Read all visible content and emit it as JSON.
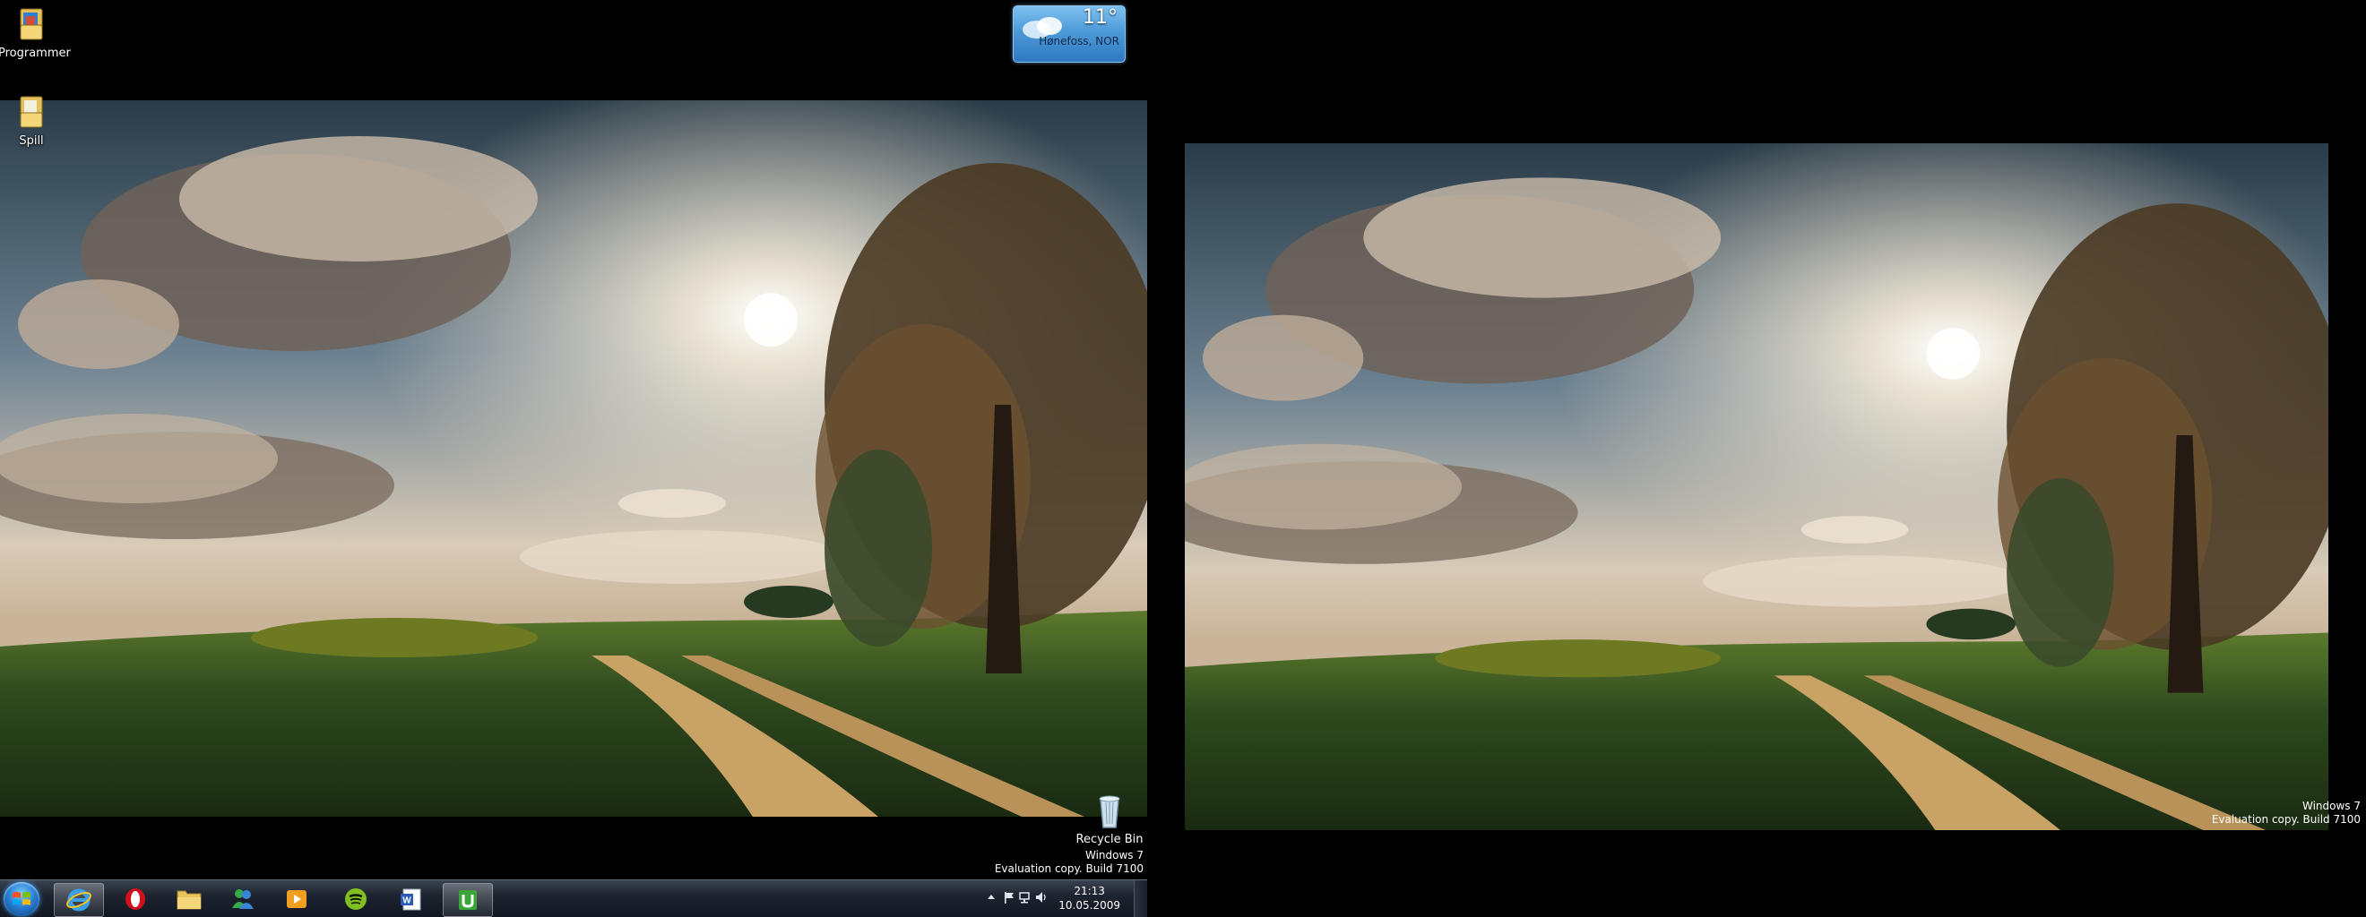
{
  "desktop": {
    "icons": [
      {
        "label": "Programmer"
      },
      {
        "label": "Spill"
      },
      {
        "label": "Recycle Bin"
      }
    ]
  },
  "weather": {
    "temperature": "11°",
    "location": "Hønefoss, NOR"
  },
  "watermark": {
    "line1": "Windows 7",
    "line2": "Evaluation copy. Build 7100"
  },
  "taskbar": {
    "start": {
      "icon": "windows-flag-icon"
    },
    "pinned": [
      {
        "name": "internet-explorer",
        "icon": "ie-icon",
        "active": true
      },
      {
        "name": "opera",
        "icon": "opera-icon",
        "active": false
      },
      {
        "name": "windows-explorer",
        "icon": "folder-icon",
        "active": false
      },
      {
        "name": "messenger",
        "icon": "messenger-icon",
        "active": false
      },
      {
        "name": "media-player",
        "icon": "media-player-icon",
        "active": false
      },
      {
        "name": "spotify",
        "icon": "spotify-icon",
        "active": false
      },
      {
        "name": "word",
        "icon": "word-icon",
        "active": false
      },
      {
        "name": "utorrent",
        "icon": "utorrent-icon",
        "active": true
      }
    ],
    "tray": {
      "time": "21:13",
      "date": "10.05.2009"
    }
  },
  "colors": {
    "taskbar": "#1d2430",
    "weather_gadget": "#4d9ad8",
    "desktop_background": "#000000"
  }
}
